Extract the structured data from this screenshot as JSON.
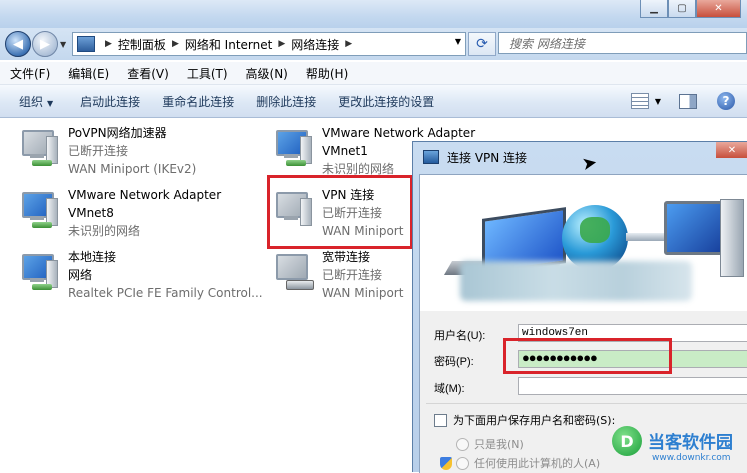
{
  "address": {
    "breadcrumbs": [
      "控制面板",
      "网络和 Internet",
      "网络连接"
    ],
    "search_placeholder": "搜索 网络连接"
  },
  "menu": [
    "文件(F)",
    "编辑(E)",
    "查看(V)",
    "工具(T)",
    "高级(N)",
    "帮助(H)"
  ],
  "commands": {
    "organize": "组织",
    "start": "启动此连接",
    "rename": "重命名此连接",
    "delete": "删除此连接",
    "settings": "更改此连接的设置"
  },
  "connections": [
    {
      "name": "PoVPN网络加速器",
      "line2": "已断开连接",
      "line3": "WAN Miniport (IKEv2)"
    },
    {
      "name": "VMware Network Adapter",
      "line2": "VMnet1",
      "line3": "未识别的网络"
    },
    {
      "name": "VMware Network Adapter",
      "line2": "VMnet8",
      "line3": "未识别的网络"
    },
    {
      "name": "VPN 连接",
      "line2": "已断开连接",
      "line3": "WAN Miniport"
    },
    {
      "name": "本地连接",
      "line2": "网络",
      "line3": "Realtek PCIe FE Family Control..."
    },
    {
      "name": "宽带连接",
      "line2": "已断开连接",
      "line3": "WAN Miniport"
    }
  ],
  "dialog": {
    "title": "连接 VPN 连接",
    "username_label": "用户名(U):",
    "username_value": "windows7en",
    "password_label": "密码(P):",
    "password_value": "●●●●●●●●●●●",
    "domain_label": "域(M):",
    "domain_value": "",
    "save_label": "为下面用户保存用户名和密码(S):",
    "only_me": "只是我(N)",
    "anyone": "任何使用此计算机的人(A)"
  },
  "watermark": {
    "title": "当客软件园",
    "url": "www.downkr.com",
    "logo_glyph": "D"
  },
  "colors": {
    "highlight_box": "#d9232a",
    "password_fill": "#c9ecc6"
  }
}
